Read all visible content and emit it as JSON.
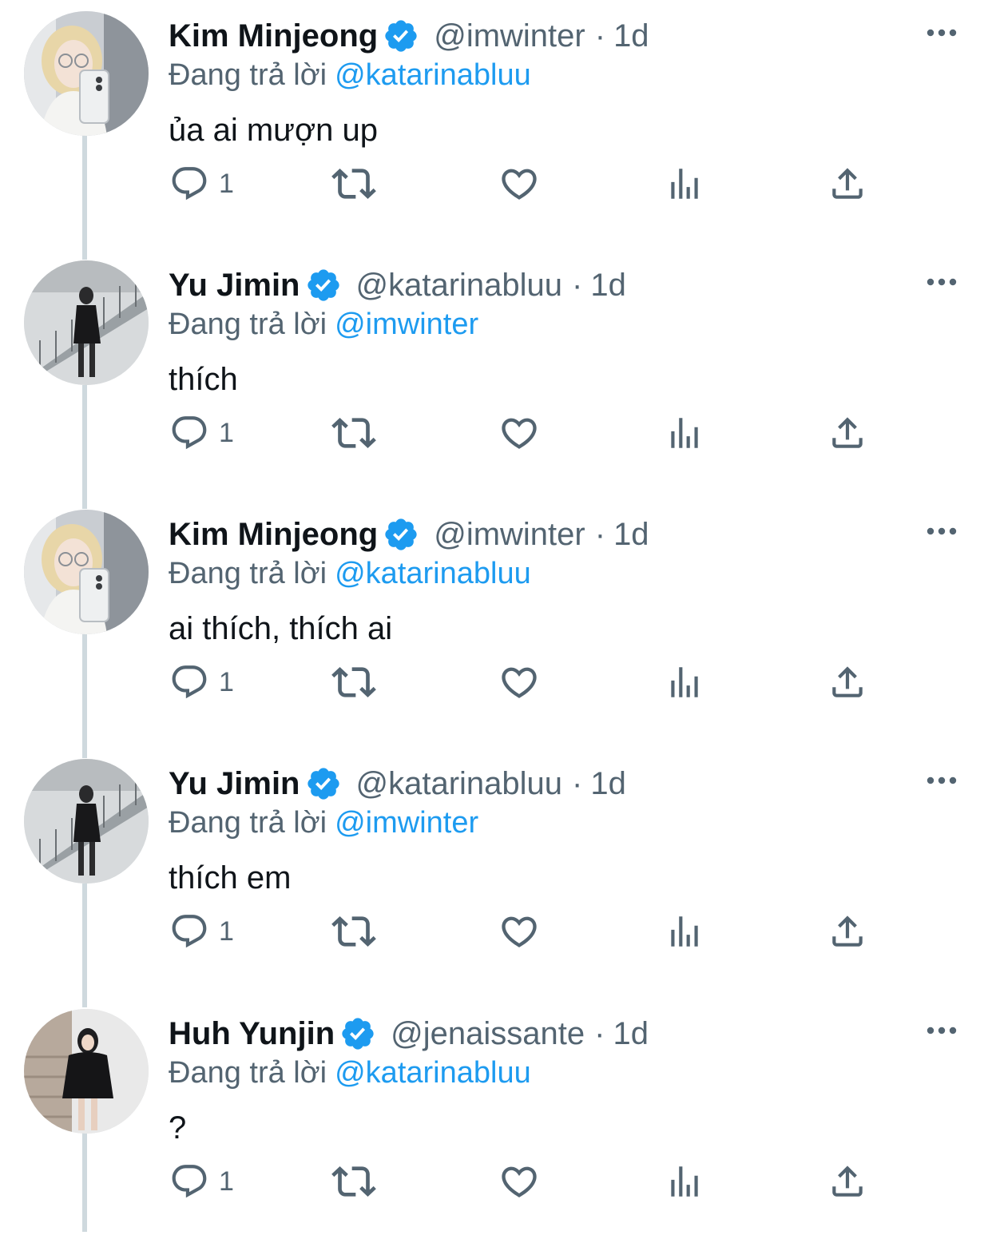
{
  "thread": {
    "reply_prefix": "Đang trả lời",
    "tweets": [
      {
        "name": "Kim Minjeong",
        "handle": "@imwinter",
        "separator": "·",
        "time": "1d",
        "reply_to": "@katarinabluu",
        "text": "ủa ai mượn up",
        "reply_count": "1",
        "avatar": "winter-avatar"
      },
      {
        "name": "Yu Jimin",
        "handle": "@katarinabluu",
        "separator": "·",
        "time": "1d",
        "reply_to": "@imwinter",
        "text": "thích",
        "reply_count": "1",
        "avatar": "karina-avatar"
      },
      {
        "name": "Kim Minjeong",
        "handle": "@imwinter",
        "separator": "·",
        "time": "1d",
        "reply_to": "@katarinabluu",
        "text": "ai thích, thích ai",
        "reply_count": "1",
        "avatar": "winter-avatar"
      },
      {
        "name": "Yu Jimin",
        "handle": "@katarinabluu",
        "separator": "·",
        "time": "1d",
        "reply_to": "@imwinter",
        "text": "thích em",
        "reply_count": "1",
        "avatar": "karina-avatar"
      },
      {
        "name": "Huh Yunjin",
        "handle": "@jenaissante",
        "separator": "·",
        "time": "1d",
        "reply_to": "@katarinabluu",
        "text": "?",
        "reply_count": "1",
        "avatar": "yunjin-avatar"
      }
    ]
  },
  "icons": {
    "verified": "verified-badge-icon",
    "more": "more-options-icon",
    "reply": "reply-icon",
    "retweet": "retweet-icon",
    "like": "heart-icon",
    "views": "views-icon",
    "share": "share-icon"
  },
  "colors": {
    "accent": "#1d9bf0",
    "text": "#0f1419",
    "secondary": "#536471",
    "thread_line": "#cfd9de"
  }
}
